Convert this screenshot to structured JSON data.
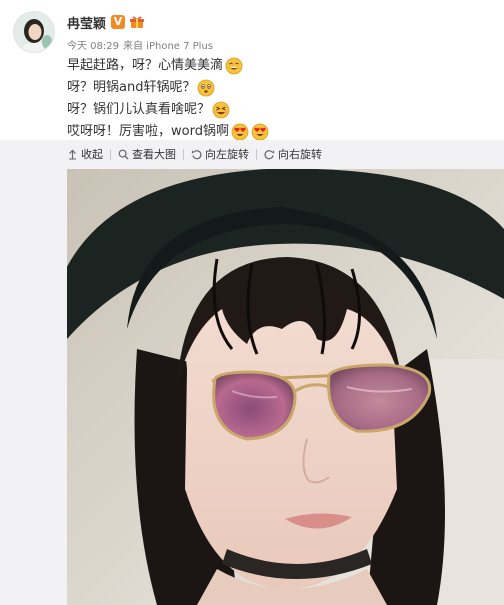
{
  "user": {
    "name": "冉莹颖",
    "verified_mark": "V",
    "avatar_icon": "user-avatar-photo",
    "vip_icon": "gift-icon"
  },
  "meta": {
    "time": "今天 08:29",
    "source": "来自 iPhone 7 Plus"
  },
  "post": {
    "lines": [
      {
        "text": "早起赶路，呀？心情美美滴",
        "emoji": [
          "grinning-face"
        ]
      },
      {
        "text": "呀？明锅and轩锅呢？",
        "emoji": [
          "flushed-face"
        ]
      },
      {
        "text": "呀？锅们儿认真看啥呢？",
        "emoji": [
          "squinting-face"
        ]
      },
      {
        "text": "哎呀呀！厉害啦，word锅啊",
        "emoji": [
          "heart-eyes-face",
          "heart-eyes-face"
        ]
      }
    ]
  },
  "toolbar": {
    "collapse": "收起",
    "view_large": "查看大图",
    "rotate_left": "向左旋转",
    "rotate_right": "向右旋转",
    "icons": [
      "collapse-arrow-icon",
      "search-icon",
      "rotate-left-icon",
      "rotate-right-icon"
    ]
  },
  "photo": {
    "description_icon": "selfie-photo"
  },
  "colors": {
    "verified": "#f18a24",
    "text": "#333333",
    "meta": "#808080",
    "panel": "#f2f2f5"
  }
}
